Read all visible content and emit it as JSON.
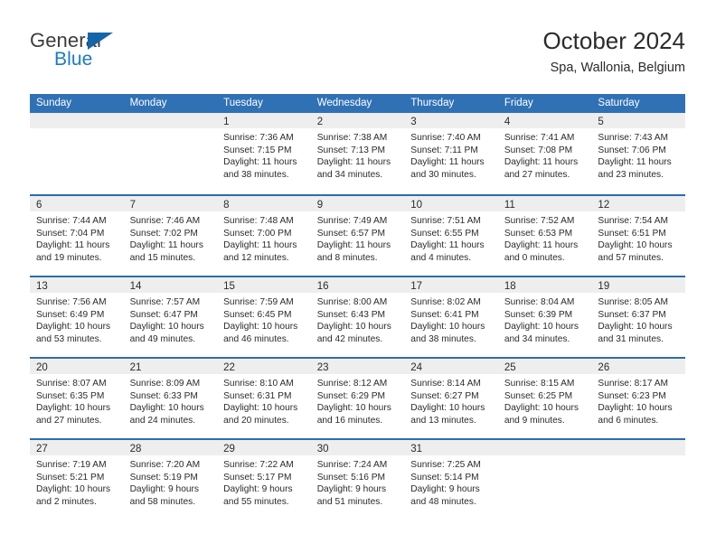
{
  "brand": {
    "name_part1": "General",
    "name_part2": "Blue",
    "logo_icon": "triangle-logo-icon"
  },
  "header": {
    "title": "October 2024",
    "location": "Spa, Wallonia, Belgium"
  },
  "calendar": {
    "weekday_headers": [
      "Sunday",
      "Monday",
      "Tuesday",
      "Wednesday",
      "Thursday",
      "Friday",
      "Saturday"
    ],
    "accent_color": "#3071b5",
    "band_color": "#eeeeee",
    "weeks": [
      [
        {
          "day": "",
          "empty": true,
          "sunrise": "",
          "sunset": "",
          "daylight1": "",
          "daylight2": ""
        },
        {
          "day": "",
          "empty": true,
          "sunrise": "",
          "sunset": "",
          "daylight1": "",
          "daylight2": ""
        },
        {
          "day": "1",
          "sunrise": "Sunrise: 7:36 AM",
          "sunset": "Sunset: 7:15 PM",
          "daylight1": "Daylight: 11 hours",
          "daylight2": "and 38 minutes."
        },
        {
          "day": "2",
          "sunrise": "Sunrise: 7:38 AM",
          "sunset": "Sunset: 7:13 PM",
          "daylight1": "Daylight: 11 hours",
          "daylight2": "and 34 minutes."
        },
        {
          "day": "3",
          "sunrise": "Sunrise: 7:40 AM",
          "sunset": "Sunset: 7:11 PM",
          "daylight1": "Daylight: 11 hours",
          "daylight2": "and 30 minutes."
        },
        {
          "day": "4",
          "sunrise": "Sunrise: 7:41 AM",
          "sunset": "Sunset: 7:08 PM",
          "daylight1": "Daylight: 11 hours",
          "daylight2": "and 27 minutes."
        },
        {
          "day": "5",
          "sunrise": "Sunrise: 7:43 AM",
          "sunset": "Sunset: 7:06 PM",
          "daylight1": "Daylight: 11 hours",
          "daylight2": "and 23 minutes."
        }
      ],
      [
        {
          "day": "6",
          "sunrise": "Sunrise: 7:44 AM",
          "sunset": "Sunset: 7:04 PM",
          "daylight1": "Daylight: 11 hours",
          "daylight2": "and 19 minutes."
        },
        {
          "day": "7",
          "sunrise": "Sunrise: 7:46 AM",
          "sunset": "Sunset: 7:02 PM",
          "daylight1": "Daylight: 11 hours",
          "daylight2": "and 15 minutes."
        },
        {
          "day": "8",
          "sunrise": "Sunrise: 7:48 AM",
          "sunset": "Sunset: 7:00 PM",
          "daylight1": "Daylight: 11 hours",
          "daylight2": "and 12 minutes."
        },
        {
          "day": "9",
          "sunrise": "Sunrise: 7:49 AM",
          "sunset": "Sunset: 6:57 PM",
          "daylight1": "Daylight: 11 hours",
          "daylight2": "and 8 minutes."
        },
        {
          "day": "10",
          "sunrise": "Sunrise: 7:51 AM",
          "sunset": "Sunset: 6:55 PM",
          "daylight1": "Daylight: 11 hours",
          "daylight2": "and 4 minutes."
        },
        {
          "day": "11",
          "sunrise": "Sunrise: 7:52 AM",
          "sunset": "Sunset: 6:53 PM",
          "daylight1": "Daylight: 11 hours",
          "daylight2": "and 0 minutes."
        },
        {
          "day": "12",
          "sunrise": "Sunrise: 7:54 AM",
          "sunset": "Sunset: 6:51 PM",
          "daylight1": "Daylight: 10 hours",
          "daylight2": "and 57 minutes."
        }
      ],
      [
        {
          "day": "13",
          "sunrise": "Sunrise: 7:56 AM",
          "sunset": "Sunset: 6:49 PM",
          "daylight1": "Daylight: 10 hours",
          "daylight2": "and 53 minutes."
        },
        {
          "day": "14",
          "sunrise": "Sunrise: 7:57 AM",
          "sunset": "Sunset: 6:47 PM",
          "daylight1": "Daylight: 10 hours",
          "daylight2": "and 49 minutes."
        },
        {
          "day": "15",
          "sunrise": "Sunrise: 7:59 AM",
          "sunset": "Sunset: 6:45 PM",
          "daylight1": "Daylight: 10 hours",
          "daylight2": "and 46 minutes."
        },
        {
          "day": "16",
          "sunrise": "Sunrise: 8:00 AM",
          "sunset": "Sunset: 6:43 PM",
          "daylight1": "Daylight: 10 hours",
          "daylight2": "and 42 minutes."
        },
        {
          "day": "17",
          "sunrise": "Sunrise: 8:02 AM",
          "sunset": "Sunset: 6:41 PM",
          "daylight1": "Daylight: 10 hours",
          "daylight2": "and 38 minutes."
        },
        {
          "day": "18",
          "sunrise": "Sunrise: 8:04 AM",
          "sunset": "Sunset: 6:39 PM",
          "daylight1": "Daylight: 10 hours",
          "daylight2": "and 34 minutes."
        },
        {
          "day": "19",
          "sunrise": "Sunrise: 8:05 AM",
          "sunset": "Sunset: 6:37 PM",
          "daylight1": "Daylight: 10 hours",
          "daylight2": "and 31 minutes."
        }
      ],
      [
        {
          "day": "20",
          "sunrise": "Sunrise: 8:07 AM",
          "sunset": "Sunset: 6:35 PM",
          "daylight1": "Daylight: 10 hours",
          "daylight2": "and 27 minutes."
        },
        {
          "day": "21",
          "sunrise": "Sunrise: 8:09 AM",
          "sunset": "Sunset: 6:33 PM",
          "daylight1": "Daylight: 10 hours",
          "daylight2": "and 24 minutes."
        },
        {
          "day": "22",
          "sunrise": "Sunrise: 8:10 AM",
          "sunset": "Sunset: 6:31 PM",
          "daylight1": "Daylight: 10 hours",
          "daylight2": "and 20 minutes."
        },
        {
          "day": "23",
          "sunrise": "Sunrise: 8:12 AM",
          "sunset": "Sunset: 6:29 PM",
          "daylight1": "Daylight: 10 hours",
          "daylight2": "and 16 minutes."
        },
        {
          "day": "24",
          "sunrise": "Sunrise: 8:14 AM",
          "sunset": "Sunset: 6:27 PM",
          "daylight1": "Daylight: 10 hours",
          "daylight2": "and 13 minutes."
        },
        {
          "day": "25",
          "sunrise": "Sunrise: 8:15 AM",
          "sunset": "Sunset: 6:25 PM",
          "daylight1": "Daylight: 10 hours",
          "daylight2": "and 9 minutes."
        },
        {
          "day": "26",
          "sunrise": "Sunrise: 8:17 AM",
          "sunset": "Sunset: 6:23 PM",
          "daylight1": "Daylight: 10 hours",
          "daylight2": "and 6 minutes."
        }
      ],
      [
        {
          "day": "27",
          "sunrise": "Sunrise: 7:19 AM",
          "sunset": "Sunset: 5:21 PM",
          "daylight1": "Daylight: 10 hours",
          "daylight2": "and 2 minutes."
        },
        {
          "day": "28",
          "sunrise": "Sunrise: 7:20 AM",
          "sunset": "Sunset: 5:19 PM",
          "daylight1": "Daylight: 9 hours",
          "daylight2": "and 58 minutes."
        },
        {
          "day": "29",
          "sunrise": "Sunrise: 7:22 AM",
          "sunset": "Sunset: 5:17 PM",
          "daylight1": "Daylight: 9 hours",
          "daylight2": "and 55 minutes."
        },
        {
          "day": "30",
          "sunrise": "Sunrise: 7:24 AM",
          "sunset": "Sunset: 5:16 PM",
          "daylight1": "Daylight: 9 hours",
          "daylight2": "and 51 minutes."
        },
        {
          "day": "31",
          "sunrise": "Sunrise: 7:25 AM",
          "sunset": "Sunset: 5:14 PM",
          "daylight1": "Daylight: 9 hours",
          "daylight2": "and 48 minutes."
        },
        {
          "day": "",
          "empty": true,
          "sunrise": "",
          "sunset": "",
          "daylight1": "",
          "daylight2": ""
        },
        {
          "day": "",
          "empty": true,
          "sunrise": "",
          "sunset": "",
          "daylight1": "",
          "daylight2": ""
        }
      ]
    ]
  }
}
